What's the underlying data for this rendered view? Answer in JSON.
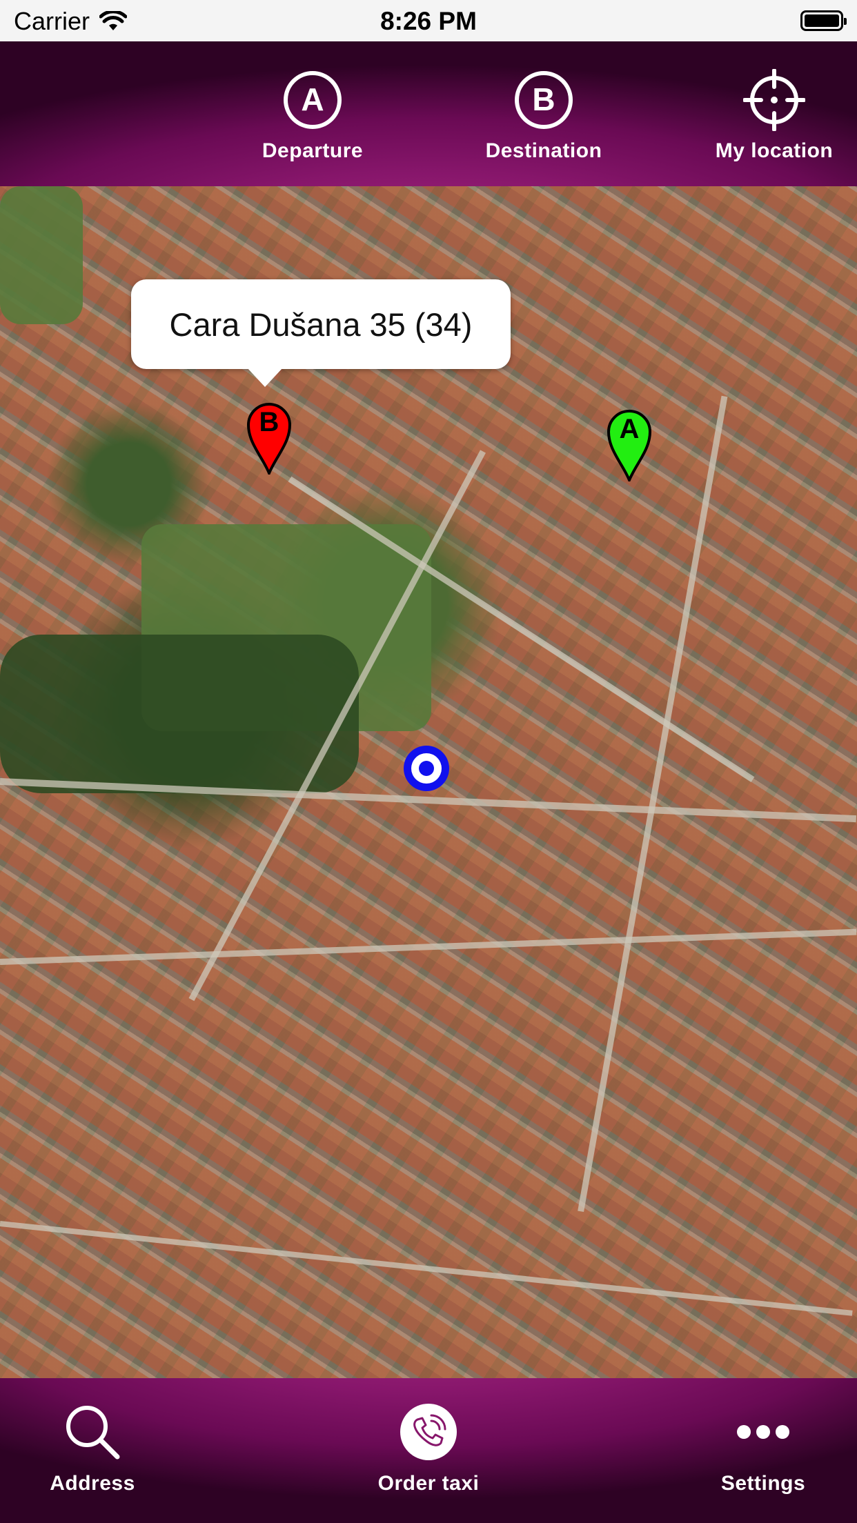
{
  "status_bar": {
    "carrier": "Carrier",
    "time": "8:26 PM"
  },
  "top_bar": {
    "departure_label": "Departure",
    "destination_label": "Destination",
    "my_location_label": "My location",
    "departure_icon_letter": "A",
    "destination_icon_letter": "B"
  },
  "map": {
    "callout_text": "Cara Dušana 35 (34)",
    "pin_b_letter": "B",
    "pin_a_letter": "A",
    "pin_b_color": "#ff0000",
    "pin_a_color": "#22ee11",
    "my_location_color": "#1010ee"
  },
  "bottom_bar": {
    "address_label": "Address",
    "order_taxi_label": "Order taxi",
    "settings_label": "Settings"
  },
  "colors": {
    "bar_accent": "#87166b",
    "bar_dark": "#2e0224"
  },
  "icons": [
    "wifi-icon",
    "battery-icon",
    "departure-icon",
    "destination-icon",
    "crosshair-icon",
    "search-icon",
    "phone-icon",
    "more-icon"
  ]
}
